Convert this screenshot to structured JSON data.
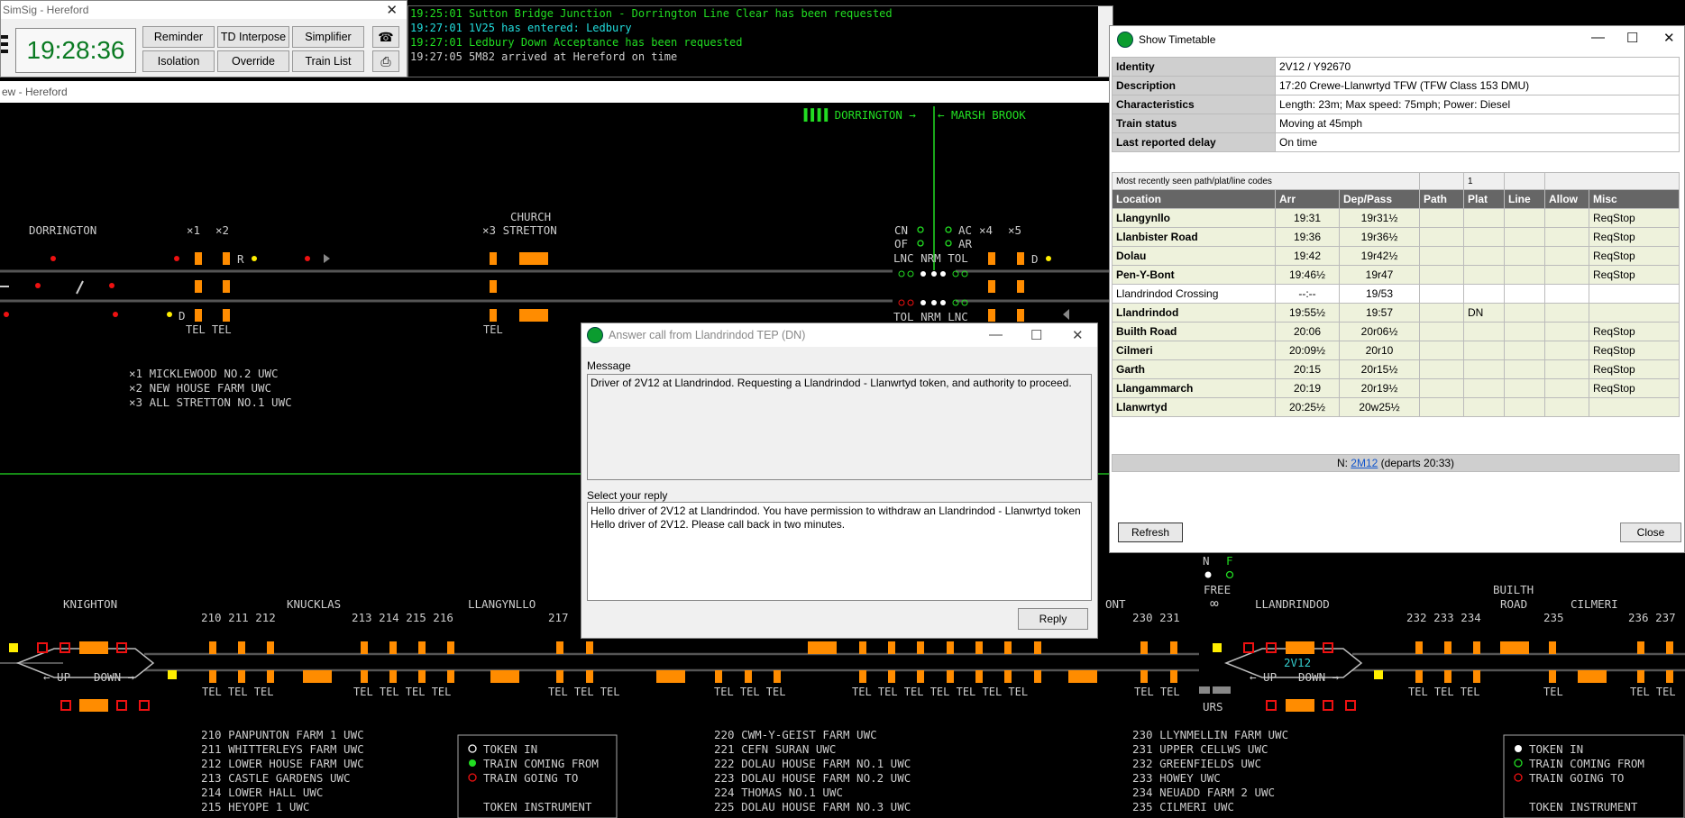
{
  "clock_window": {
    "title": "SimSig - Hereford",
    "time": "19:28:36",
    "buttons": [
      "Reminder",
      "TD Interpose",
      "Simplifier",
      "Isolation",
      "Override",
      "Train List"
    ],
    "phone_icon": "phone-icon",
    "print_icon": "printer-icon"
  },
  "messages": [
    {
      "text": "19:25:01 Sutton Bridge Junction - Dorrington Line Clear has been requested",
      "color": "#22dd22"
    },
    {
      "text": "19:27:01 1V25 has entered: Ledbury",
      "color": "#22dddd"
    },
    {
      "text": "19:27:01 Ledbury Down Acceptance has been requested",
      "color": "#22dd22"
    },
    {
      "text": "19:27:05 5M82 arrived at Hereford on time",
      "color": "#cccccc"
    }
  ],
  "sim_window_title": "ew - Hereford",
  "diagram": {
    "top_labels": {
      "dorrington_arrow": "▐▐▐▐ DORRINGTON →",
      "marsh_brook": "← MARSH BROOK",
      "dorrington": "DORRINGTON",
      "x1": "×1",
      "x2": "×2",
      "church": "CHURCH",
      "x3_stretton": "×3 STRETTON",
      "cn": "CN",
      "of": "OF",
      "ac": "AC",
      "ar": "AR",
      "x4": "×4",
      "x5": "×5",
      "lnc_nrm_tol_top": "LNC NRM TOL",
      "tol_nrm_lnc_bot": "TOL NRM LNC",
      "r": "R",
      "d1": "D",
      "d2": "D"
    },
    "top_tel": [
      "TEL TEL",
      "TEL"
    ],
    "top_legend": [
      "×1 MICKLEWOOD NO.2 UWC",
      "×2 NEW HOUSE FARM UWC",
      "×3 ALL STRETTON NO.1 UWC"
    ],
    "bottom_labels": {
      "n": "N",
      "f": "F",
      "free": "FREE",
      "infinity": "∞",
      "knighton": "KNIGHTON",
      "knucklas": "KNUCKLAS",
      "llangynllo": "LLANGYNLLO",
      "ont": "ONT",
      "llandrindod": "LLANDRINDOD",
      "builth": "BUILTH",
      "road": "ROAD",
      "cilmeri": "CILMERI",
      "up1": "← UP",
      "down1": "DOWN →",
      "up2": "← UP",
      "down2": "DOWN →",
      "train_id": "2V12",
      "urs": "URS"
    },
    "crossing_numbers": [
      {
        "t": "210 211 212"
      },
      {
        "t": "213 214 215 216"
      },
      {
        "t": "217"
      },
      {
        "t": "230 231"
      },
      {
        "t": "232 233 234"
      },
      {
        "t": "235"
      },
      {
        "t": "236 237"
      }
    ],
    "bottom_tel": [
      "TEL TEL TEL",
      "TEL TEL TEL TEL",
      "TEL TEL TEL",
      "TEL TEL TEL",
      "TEL TEL TEL TEL TEL TEL TEL",
      "TEL TEL",
      "TEL TEL TEL",
      "TEL",
      "TEL TEL"
    ],
    "legend_left": [
      "210 PANPUNTON FARM 1 UWC",
      "211 WHITTERLEYS FARM UWC",
      "212 LOWER HOUSE FARM UWC",
      "213 CASTLE GARDENS UWC",
      "214 LOWER HALL UWC",
      "215 HEYOPE 1 UWC"
    ],
    "legend_mid": [
      "220 CWM-Y-GEIST FARM UWC",
      "221 CEFN SURAN UWC",
      "222 DOLAU HOUSE FARM NO.1 UWC",
      "223 DOLAU HOUSE FARM NO.2 UWC",
      "224 THOMAS NO.1 UWC",
      "225 DOLAU HOUSE FARM NO.3 UWC"
    ],
    "legend_right": [
      "230 LLYNMELLIN FARM UWC",
      "231 UPPER CELLWS UWC",
      "232 GREENFIELDS UWC",
      "233 HOWEY UWC",
      "234 NEUADD FARM 2 UWC",
      "235 CILMERI UWC"
    ],
    "token_key": {
      "token_in": "TOKEN IN",
      "coming_from": "TRAIN COMING FROM",
      "going_to": "TRAIN GOING TO",
      "instrument": "TOKEN INSTRUMENT"
    }
  },
  "timetable": {
    "title": "Show Timetable",
    "info": [
      {
        "k": "Identity",
        "v": "2V12 / Y92670"
      },
      {
        "k": "Description",
        "v": "17:20 Crewe-Llanwrtyd TFW (TFW Class 153 DMU)"
      },
      {
        "k": "Characteristics",
        "v": "Length: 23m; Max speed: 75mph; Power: Diesel"
      },
      {
        "k": "Train status",
        "v": "Moving at 45mph"
      },
      {
        "k": "Last reported delay",
        "v": "On time"
      }
    ],
    "header1": {
      "label": "Most recently seen path/plat/line codes",
      "plat": "1"
    },
    "columns": [
      "Location",
      "Arr",
      "Dep/Pass",
      "Path",
      "Plat",
      "Line",
      "Allow",
      "Misc"
    ],
    "rows": [
      {
        "loc": "Llangynllo",
        "arr": "19:31",
        "dep": "19r31½",
        "path": "",
        "plat": "",
        "line": "",
        "allow": "",
        "misc": "ReqStop",
        "bold": true
      },
      {
        "loc": "Llanbister Road",
        "arr": "19:36",
        "dep": "19r36½",
        "path": "",
        "plat": "",
        "line": "",
        "allow": "",
        "misc": "ReqStop",
        "bold": true
      },
      {
        "loc": "Dolau",
        "arr": "19:42",
        "dep": "19r42½",
        "path": "",
        "plat": "",
        "line": "",
        "allow": "",
        "misc": "ReqStop",
        "bold": true
      },
      {
        "loc": "Pen-Y-Bont",
        "arr": "19:46½",
        "dep": "19r47",
        "path": "",
        "plat": "",
        "line": "",
        "allow": "",
        "misc": "ReqStop",
        "bold": true
      },
      {
        "loc": "Llandrindod Crossing",
        "arr": "--:--",
        "dep": "19/53",
        "path": "",
        "plat": "",
        "line": "",
        "allow": "",
        "misc": "",
        "bold": false
      },
      {
        "loc": "Llandrindod",
        "arr": "19:55½",
        "dep": "19:57",
        "path": "",
        "plat": "DN",
        "line": "",
        "allow": "",
        "misc": "",
        "bold": true
      },
      {
        "loc": "Builth Road",
        "arr": "20:06",
        "dep": "20r06½",
        "path": "",
        "plat": "",
        "line": "",
        "allow": "",
        "misc": "ReqStop",
        "bold": true
      },
      {
        "loc": "Cilmeri",
        "arr": "20:09½",
        "dep": "20r10",
        "path": "",
        "plat": "",
        "line": "",
        "allow": "",
        "misc": "ReqStop",
        "bold": true
      },
      {
        "loc": "Garth",
        "arr": "20:15",
        "dep": "20r15½",
        "path": "",
        "plat": "",
        "line": "",
        "allow": "",
        "misc": "ReqStop",
        "bold": true
      },
      {
        "loc": "Llangammarch",
        "arr": "20:19",
        "dep": "20r19½",
        "path": "",
        "plat": "",
        "line": "",
        "allow": "",
        "misc": "ReqStop",
        "bold": true
      },
      {
        "loc": "Llanwrtyd",
        "arr": "20:25½",
        "dep": "20w25½",
        "path": "",
        "plat": "",
        "line": "",
        "allow": "",
        "misc": "",
        "bold": true
      }
    ],
    "next_prefix": "N: ",
    "next_link": "2M12",
    "next_suffix": " (departs 20:33)",
    "refresh": "Refresh",
    "close": "Close"
  },
  "call_dialog": {
    "title": "Answer call from Llandrindod TEP (DN)",
    "message_label": "Message",
    "message": "Driver of 2V12 at Llandrindod. Requesting a Llandrindod - Llanwrtyd token, and authority to proceed.",
    "reply_label": "Select your reply",
    "replies": [
      "Hello driver of 2V12 at Llandrindod. You have permission to withdraw an Llandrindod - Llanwrtyd token",
      "Hello driver of 2V12. Please call back in two minutes."
    ],
    "reply_button": "Reply"
  },
  "colors": {
    "green": "#22dd22",
    "orange": "#ff8c00",
    "red": "#ee1111",
    "yellow": "#ffee00",
    "cyan": "#22dddd"
  }
}
